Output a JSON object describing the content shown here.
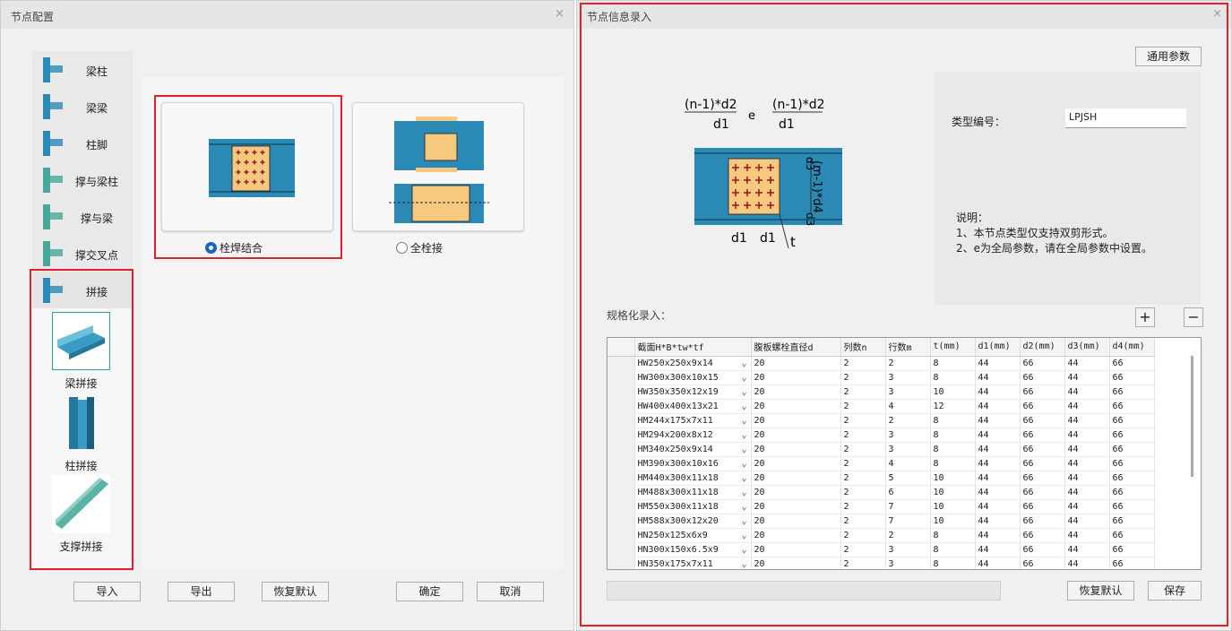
{
  "left": {
    "title": "节点配置",
    "close": "×",
    "sidebar": [
      {
        "label": "梁柱"
      },
      {
        "label": "梁梁"
      },
      {
        "label": "柱脚"
      },
      {
        "label": "撑与梁柱"
      },
      {
        "label": "撑与梁"
      },
      {
        "label": "撑交叉点"
      },
      {
        "label": "拼接"
      }
    ],
    "sub_items": [
      {
        "label": "梁拼接"
      },
      {
        "label": "柱拼接"
      },
      {
        "label": "支撑拼接"
      }
    ],
    "options": [
      {
        "label": "栓焊结合",
        "selected": true
      },
      {
        "label": "全栓接",
        "selected": false
      }
    ],
    "buttons": {
      "import": "导入",
      "export": "导出",
      "reset": "恢复默认",
      "ok": "确定",
      "cancel": "取消"
    }
  },
  "right": {
    "title": "节点信息录入",
    "close": "×",
    "common_params": "通用参数",
    "diagram": {
      "n_d2": "(n-1)*d2",
      "d1": "d1",
      "e": "e",
      "d3": "d3",
      "m_d4": "(m-1)*d4",
      "t": "t"
    },
    "type_label": "类型编号：",
    "type_value": "LPJSH",
    "note_title": "说明：",
    "note_lines": [
      "1、本节点类型仅支持双剪形式。",
      "2、e为全局参数，请在全局参数中设置。"
    ],
    "spec_label": "规格化录入：",
    "add": "+",
    "remove": "−",
    "table": {
      "headers": [
        "截面H*B*tw*tf",
        "腹板螺栓直径d",
        "列数n",
        "行数m",
        "t(mm)",
        "d1(mm)",
        "d2(mm)",
        "d3(mm)",
        "d4(mm)"
      ],
      "rows": [
        [
          "HW250x250x9x14",
          "20",
          "2",
          "2",
          "8",
          "44",
          "66",
          "44",
          "66"
        ],
        [
          "HW300x300x10x15",
          "20",
          "2",
          "3",
          "8",
          "44",
          "66",
          "44",
          "66"
        ],
        [
          "HW350x350x12x19",
          "20",
          "2",
          "3",
          "10",
          "44",
          "66",
          "44",
          "66"
        ],
        [
          "HW400x400x13x21",
          "20",
          "2",
          "4",
          "12",
          "44",
          "66",
          "44",
          "66"
        ],
        [
          "HM244x175x7x11",
          "20",
          "2",
          "2",
          "8",
          "44",
          "66",
          "44",
          "66"
        ],
        [
          "HM294x200x8x12",
          "20",
          "2",
          "3",
          "8",
          "44",
          "66",
          "44",
          "66"
        ],
        [
          "HM340x250x9x14",
          "20",
          "2",
          "3",
          "8",
          "44",
          "66",
          "44",
          "66"
        ],
        [
          "HM390x300x10x16",
          "20",
          "2",
          "4",
          "8",
          "44",
          "66",
          "44",
          "66"
        ],
        [
          "HM440x300x11x18",
          "20",
          "2",
          "5",
          "10",
          "44",
          "66",
          "44",
          "66"
        ],
        [
          "HM488x300x11x18",
          "20",
          "2",
          "6",
          "10",
          "44",
          "66",
          "44",
          "66"
        ],
        [
          "HM550x300x11x18",
          "20",
          "2",
          "7",
          "10",
          "44",
          "66",
          "44",
          "66"
        ],
        [
          "HM588x300x12x20",
          "20",
          "2",
          "7",
          "10",
          "44",
          "66",
          "44",
          "66"
        ],
        [
          "HN250x125x6x9",
          "20",
          "2",
          "2",
          "8",
          "44",
          "66",
          "44",
          "66"
        ],
        [
          "HN300x150x6.5x9",
          "20",
          "2",
          "3",
          "8",
          "44",
          "66",
          "44",
          "66"
        ],
        [
          "HN350x175x7x11",
          "20",
          "2",
          "3",
          "8",
          "44",
          "66",
          "44",
          "66"
        ]
      ]
    },
    "buttons": {
      "reset": "恢复默认",
      "save": "保存"
    }
  },
  "colors": {
    "steel": "#2a8ab5",
    "plate": "#f7c97e",
    "bolt": "#a0102a",
    "highlight": "#e0202a",
    "accent": "#1a63c9"
  }
}
